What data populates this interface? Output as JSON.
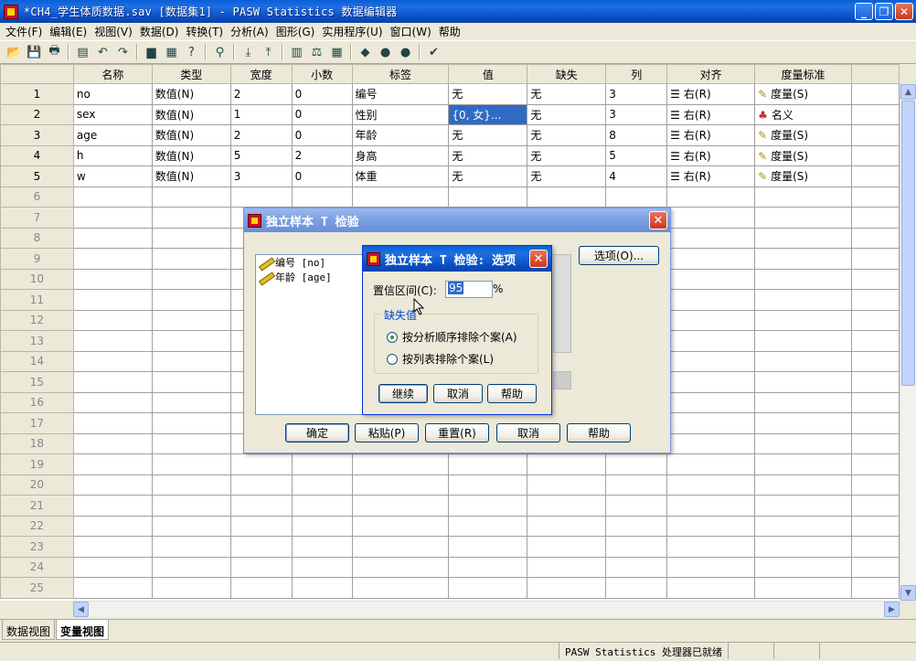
{
  "window": {
    "title": "*CH4_学生体质数据.sav [数据集1] - PASW Statistics 数据编辑器",
    "minimize_glyph": "_",
    "restore_glyph": "❐",
    "close_glyph": "✕"
  },
  "menu": [
    {
      "label": "文件(F)"
    },
    {
      "label": "编辑(E)"
    },
    {
      "label": "视图(V)"
    },
    {
      "label": "数据(D)"
    },
    {
      "label": "转换(T)"
    },
    {
      "label": "分析(A)"
    },
    {
      "label": "图形(G)"
    },
    {
      "label": "实用程序(U)"
    },
    {
      "label": "窗口(W)"
    },
    {
      "label": "帮助"
    }
  ],
  "toolbar_icons": [
    "open-icon",
    "save-icon",
    "print-icon",
    "dialog-recall-icon",
    "undo-icon",
    "redo-icon",
    "goto-case-icon",
    "goto-variable-icon",
    "variables-icon",
    "find-icon",
    "insert-cases-icon",
    "insert-variable-icon",
    "split-file-icon",
    "weight-cases-icon",
    "select-cases-icon",
    "value-labels-icon",
    "use-sets-icon",
    "show-all-icon",
    "spell-check-icon"
  ],
  "grid": {
    "columns": [
      "名称",
      "类型",
      "宽度",
      "小数",
      "标签",
      "值",
      "缺失",
      "列",
      "对齐",
      "度量标准"
    ],
    "rows": [
      {
        "num": "1",
        "cells": [
          "no",
          "数值(N)",
          "2",
          "0",
          "编号",
          "无",
          "无",
          "3",
          "右(R)",
          "度量(S)"
        ]
      },
      {
        "num": "2",
        "cells": [
          "sex",
          "数值(N)",
          "1",
          "0",
          "性别",
          "{0, 女}...",
          "无",
          "3",
          "右(R)",
          "名义"
        ]
      },
      {
        "num": "3",
        "cells": [
          "age",
          "数值(N)",
          "2",
          "0",
          "年龄",
          "无",
          "无",
          "8",
          "右(R)",
          "度量(S)"
        ]
      },
      {
        "num": "4",
        "cells": [
          "h",
          "数值(N)",
          "5",
          "2",
          "身高",
          "无",
          "无",
          "5",
          "右(R)",
          "度量(S)"
        ]
      },
      {
        "num": "5",
        "cells": [
          "w",
          "数值(N)",
          "3",
          "0",
          "体重",
          "无",
          "无",
          "4",
          "右(R)",
          "度量(S)"
        ]
      }
    ],
    "empty_rows": [
      "6",
      "7",
      "8",
      "9",
      "10",
      "11",
      "12",
      "13",
      "14",
      "15",
      "16",
      "17",
      "18",
      "19",
      "20",
      "21",
      "22",
      "23",
      "24",
      "25"
    ]
  },
  "tabs": {
    "data_view": "数据视图",
    "variable_view": "变量视图"
  },
  "status": {
    "processor": "PASW Statistics  处理器已就绪"
  },
  "dialog_ttest": {
    "title": "独立样本 T 检验",
    "variables": [
      {
        "label": "编号 [no]"
      },
      {
        "label": "年龄 [age]"
      }
    ],
    "options_button": "选项(O)...",
    "buttons": {
      "ok": "确定",
      "paste": "粘贴(P)",
      "reset": "重置(R)",
      "cancel": "取消",
      "help": "帮助"
    }
  },
  "dialog_options": {
    "title": "独立样本 T 检验: 选项",
    "confidence_label": "置信区间(C):",
    "confidence_value": "95",
    "percent": "%",
    "missing_group": "缺失值",
    "radio1": "按分析顺序排除个案(A)",
    "radio2": "按列表排除个案(L)",
    "buttons": {
      "continue": "继续",
      "cancel": "取消",
      "help": "帮助"
    }
  }
}
